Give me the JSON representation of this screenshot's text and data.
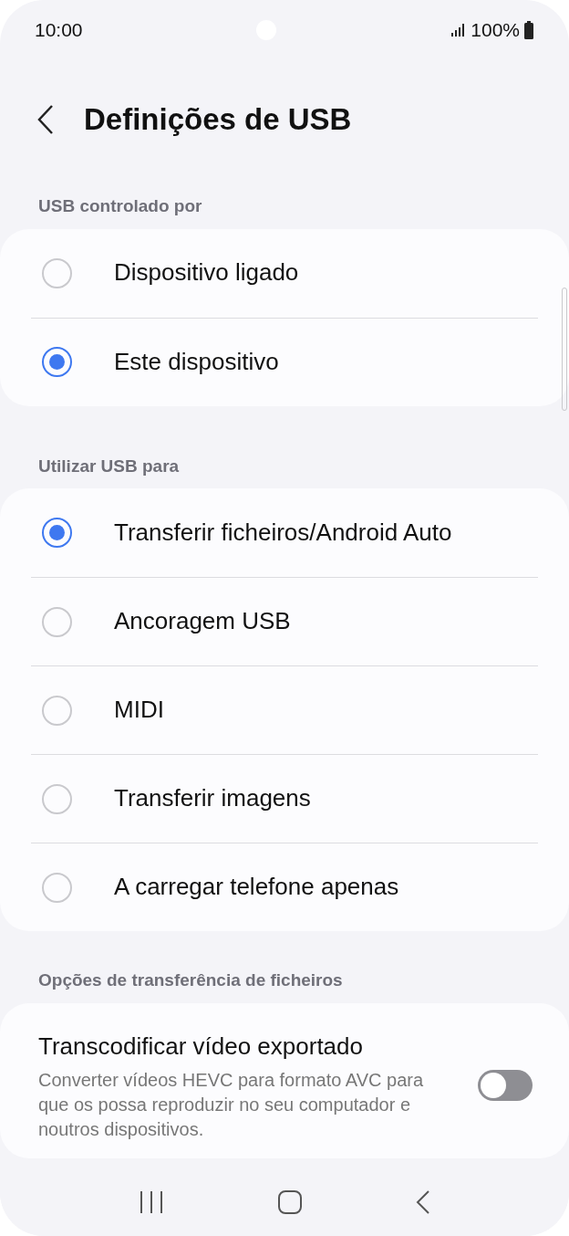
{
  "status_bar": {
    "time": "10:00",
    "battery": "100%"
  },
  "title": "Definições de USB",
  "sections": [
    {
      "label": "USB controlado por",
      "options": [
        {
          "label": "Dispositivo ligado",
          "selected": false
        },
        {
          "label": "Este dispositivo",
          "selected": true
        }
      ]
    },
    {
      "label": "Utilizar USB para",
      "options": [
        {
          "label": "Transferir ficheiros/Android Auto",
          "selected": true
        },
        {
          "label": "Ancoragem USB",
          "selected": false
        },
        {
          "label": "MIDI",
          "selected": false
        },
        {
          "label": "Transferir imagens",
          "selected": false
        },
        {
          "label": "A carregar telefone apenas",
          "selected": false
        }
      ]
    }
  ],
  "transfer_options": {
    "label": "Opções de transferência de ficheiros",
    "setting": {
      "title": "Transcodificar vídeo exportado",
      "description": "Converter vídeos HEVC para formato AVC para que os possa reproduzir no seu computador e noutros dispositivos.",
      "on": false
    }
  }
}
